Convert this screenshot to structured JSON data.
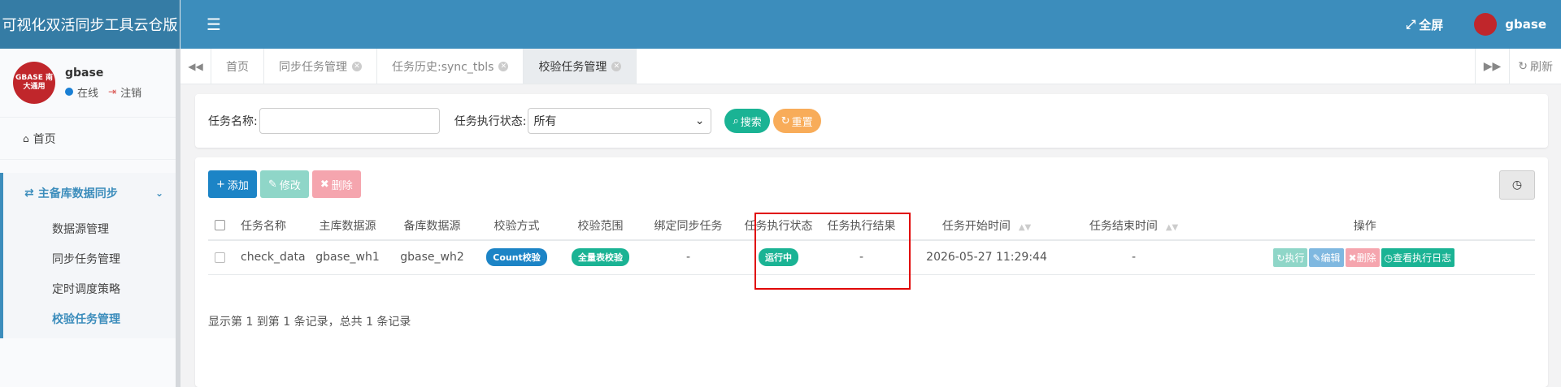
{
  "brand": {
    "title": "可视化双活同步工具云仓版"
  },
  "user": {
    "name": "gbase",
    "status": "在线",
    "logout": "注销",
    "avatar_text": "GBASE 南大通用"
  },
  "topbar": {
    "fullscreen": "全屏",
    "username": "gbase"
  },
  "sidebar": {
    "home": "首页",
    "group": "主备库数据同步",
    "items": [
      {
        "label": "数据源管理"
      },
      {
        "label": "同步任务管理"
      },
      {
        "label": "定时调度策略"
      },
      {
        "label": "校验任务管理"
      }
    ]
  },
  "tabs": [
    {
      "label": "首页"
    },
    {
      "label": "同步任务管理"
    },
    {
      "label": "任务历史:sync_tbls"
    },
    {
      "label": "校验任务管理"
    }
  ],
  "tabbar": {
    "refresh": "刷新"
  },
  "search": {
    "name_label": "任务名称:",
    "name_value": "",
    "status_label": "任务执行状态:",
    "status_value": "所有",
    "search_btn": "搜索",
    "reset_btn": "重置"
  },
  "toolbar": {
    "add": "添加",
    "edit": "修改",
    "delete": "删除"
  },
  "table": {
    "columns": [
      "任务名称",
      "主库数据源",
      "备库数据源",
      "校验方式",
      "校验范围",
      "绑定同步任务",
      "任务执行状态",
      "任务执行结果",
      "任务开始时间",
      "任务结束时间",
      "操作"
    ],
    "rows": [
      {
        "name": "check_data",
        "master": "gbase_wh1",
        "slave": "gbase_wh2",
        "method": "Count校验",
        "range": "全量表校验",
        "bind": "-",
        "status": "运行中",
        "result": "-",
        "start": "2026-05-27 11:29:44",
        "end": "-",
        "ops": {
          "exec": "执行",
          "edit": "编辑",
          "delete": "删除",
          "log": "查看执行日志"
        }
      }
    ]
  },
  "pagination": {
    "info": "显示第 1 到第 1 条记录，总共 1 条记录"
  },
  "colors": {
    "primary": "#3c8dbc",
    "teal": "#1ab394",
    "orange": "#f8ac59",
    "blue": "#1c84c6",
    "red": "#ed5565"
  }
}
